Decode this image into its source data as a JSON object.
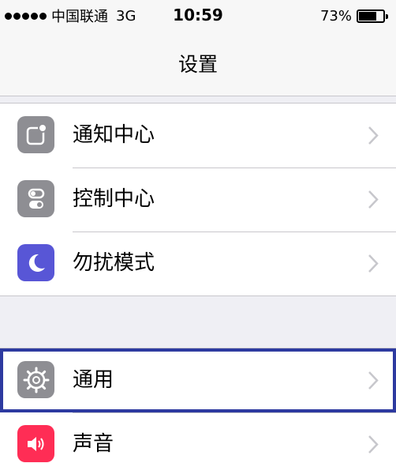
{
  "status_bar": {
    "carrier": "中国联通",
    "network": "3G",
    "time": "10:59",
    "battery": "73%",
    "battery_level": 0.73
  },
  "nav": {
    "title": "设置"
  },
  "groups": [
    {
      "items": [
        {
          "label": "通知中心",
          "icon": "notification-center-icon",
          "icon_color": "#8e8e93"
        },
        {
          "label": "控制中心",
          "icon": "control-center-icon",
          "icon_color": "#8e8e93"
        },
        {
          "label": "勿扰模式",
          "icon": "moon-icon",
          "icon_color": "#5856d6"
        }
      ]
    },
    {
      "items": [
        {
          "label": "通用",
          "icon": "gear-icon",
          "icon_color": "#8e8e93",
          "highlighted": true
        },
        {
          "label": "声音",
          "icon": "speaker-icon",
          "icon_color": "#ff2d55"
        }
      ]
    }
  ],
  "colors": {
    "highlight": "#2d3aa0",
    "separator": "#c8c7cc",
    "background": "#efeff4"
  }
}
